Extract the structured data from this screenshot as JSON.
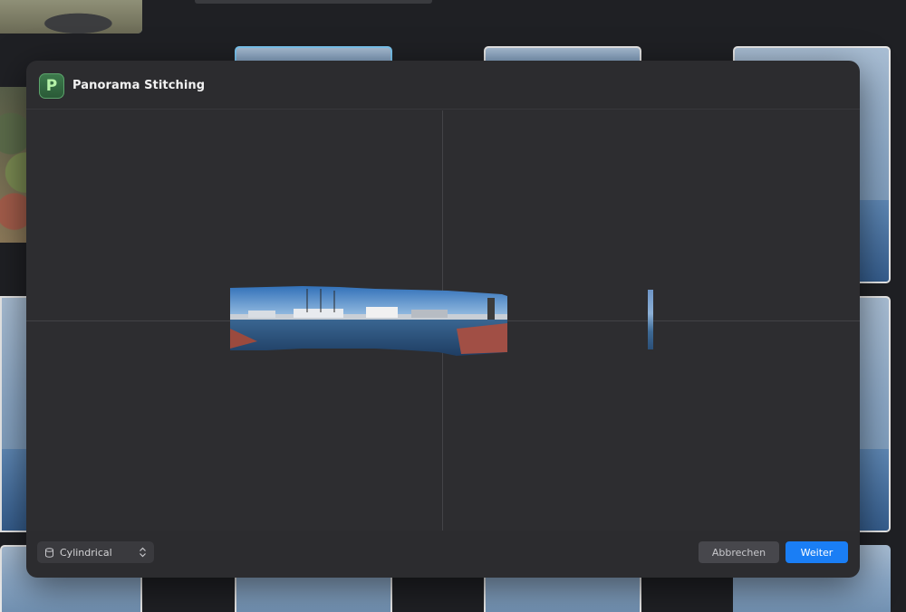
{
  "dialog": {
    "title": "Panorama Stitching",
    "app_icon_letter": "P",
    "icon": "app-icon",
    "accent_color": "#1a7ef5"
  },
  "footer": {
    "projection": {
      "selected": "Cylindrical",
      "icon": "cylinder-icon",
      "chevron_icon": "up-down-chevron-icon"
    },
    "cancel_label": "Abbrechen",
    "continue_label": "Weiter"
  }
}
